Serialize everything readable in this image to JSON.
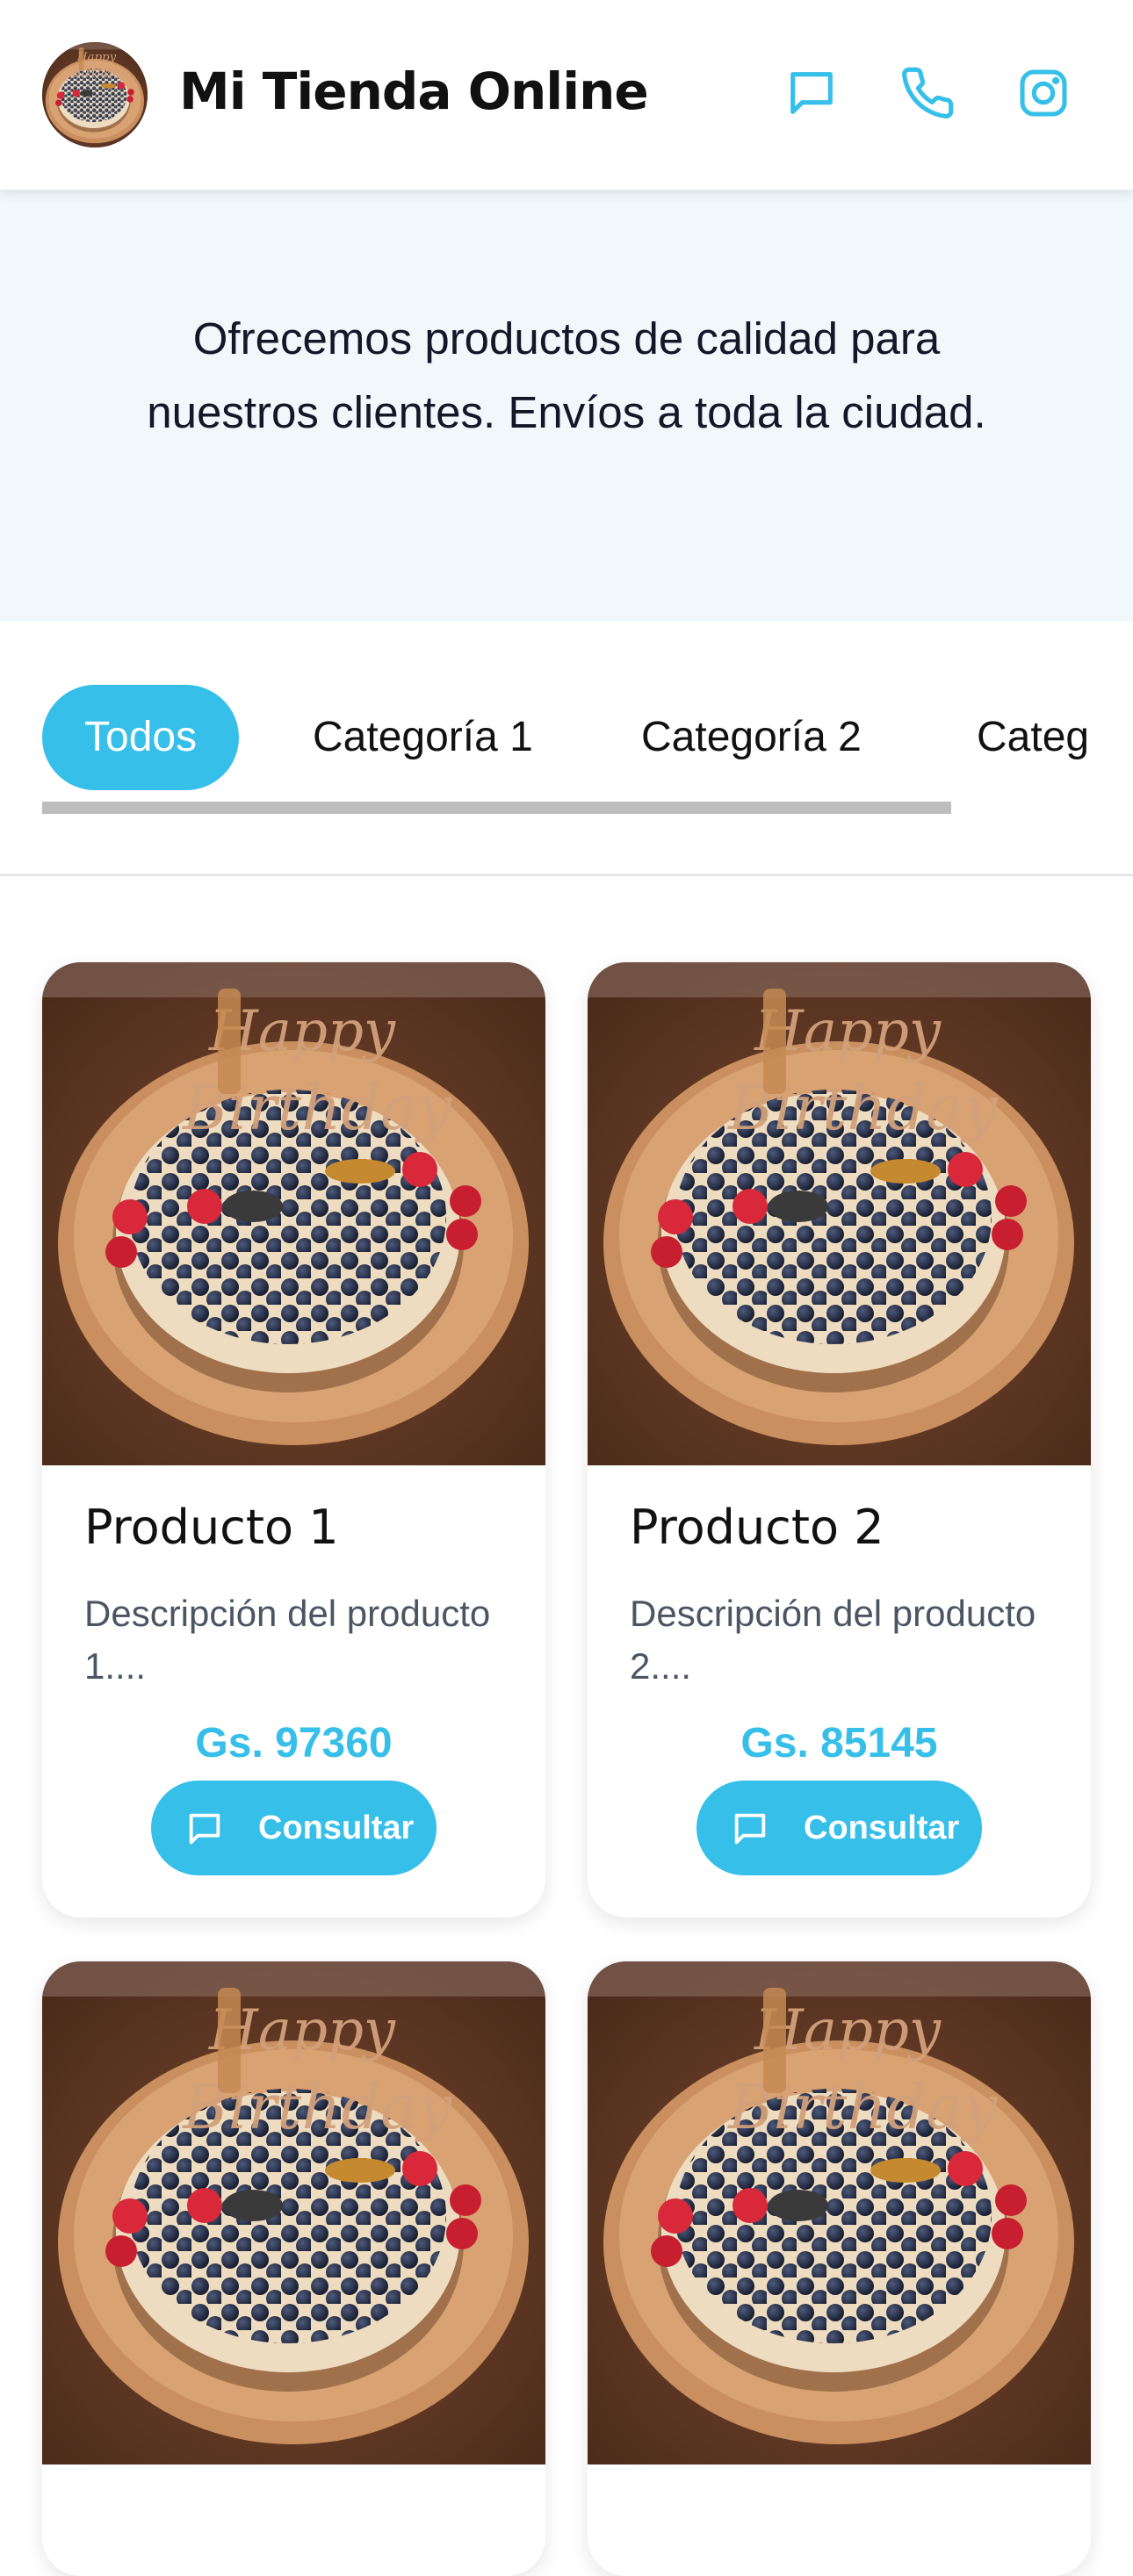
{
  "header": {
    "brand": "Mi Tienda Online",
    "icons": [
      "message-icon",
      "phone-icon",
      "instagram-icon"
    ],
    "accent_color": "#36bfe9"
  },
  "hero": {
    "text": "Ofrecemos productos de calidad para nuestros clientes. Envíos a toda la ciudad."
  },
  "categories": {
    "items": [
      "Todos",
      "Categoría 1",
      "Categoría 2",
      "Categ"
    ],
    "selected": "Todos"
  },
  "products": [
    {
      "name": "Producto 1",
      "description": "Descripción del producto 1....",
      "price": "Gs. 97360",
      "button": "Consultar"
    },
    {
      "name": "Producto 2",
      "description": "Descripción del producto 2....",
      "price": "Gs. 85145",
      "button": "Consultar"
    }
  ]
}
